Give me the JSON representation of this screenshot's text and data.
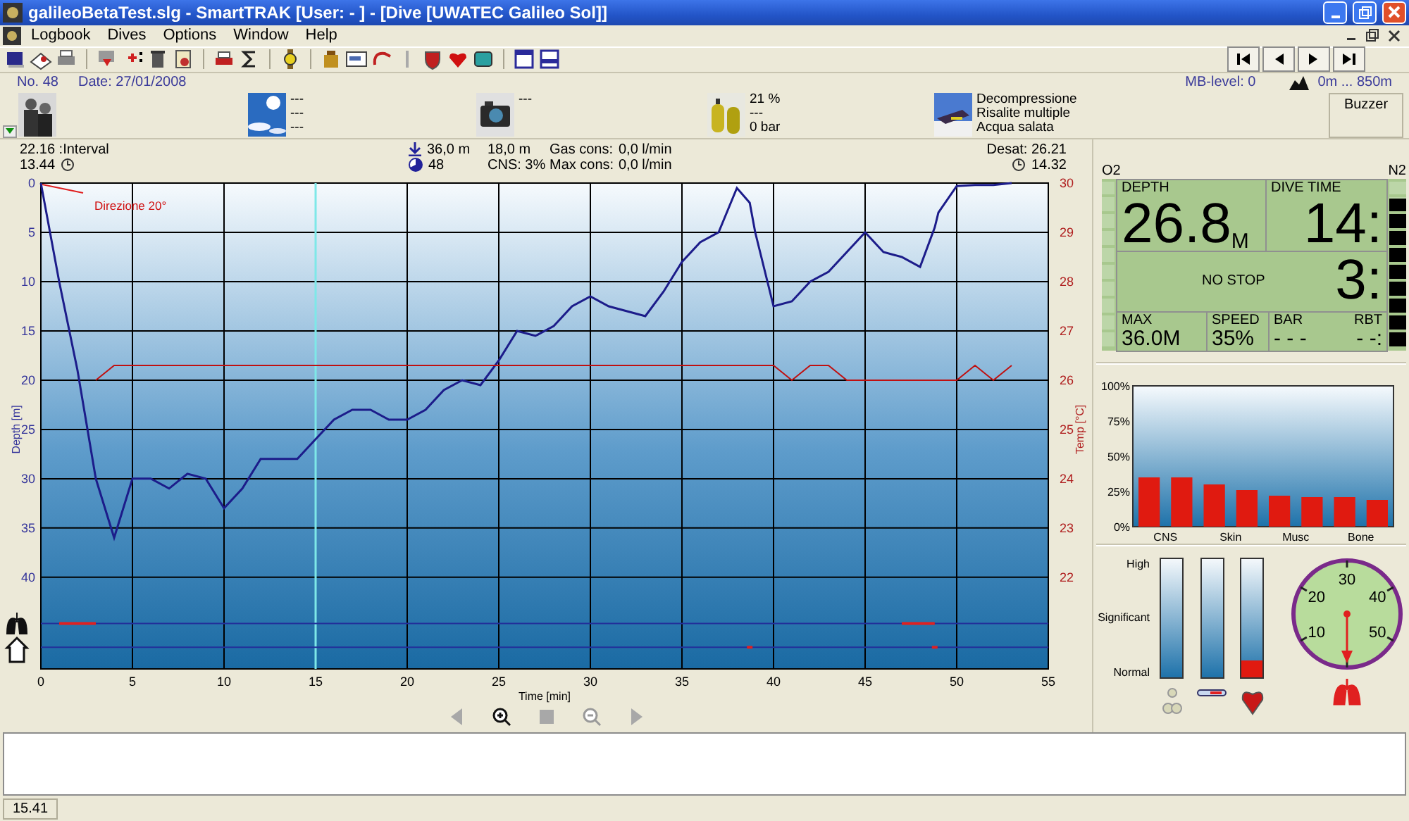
{
  "window": {
    "title": "galileoBetaTest.slg - SmartTRAK  [User:  - ] - [Dive  [UWATEC Galileo Sol]]"
  },
  "menu": [
    "Logbook",
    "Dives",
    "Options",
    "Window",
    "Help"
  ],
  "dive_info": {
    "number": "No. 48",
    "date": "Date: 27/01/2008",
    "mb_level": "MB-level: 0",
    "altitude": "0m ... 850m"
  },
  "summary": [
    {
      "kind": "buddy"
    },
    {
      "kind": "weather",
      "lines": [
        "---",
        "---",
        "---"
      ]
    },
    {
      "kind": "equipment",
      "lines": [
        "---"
      ]
    },
    {
      "kind": "gas",
      "lines": [
        "21 %",
        "---",
        "0 bar"
      ]
    },
    {
      "kind": "dive_type",
      "lines": [
        "Decompressione",
        "Risalite multiple",
        "Acqua salata"
      ]
    }
  ],
  "buzzer": "Buzzer",
  "stats": {
    "interval": "22.16 :Interval",
    "interval_time": "13.44",
    "max_depth": "36,0 m",
    "avg_depth": "18,0 m",
    "cns_count": "48",
    "cns": "CNS: 3%",
    "gas_cons_label": "Gas cons:",
    "gas_cons": "0,0 l/min",
    "max_cons_label": "Max cons:",
    "max_cons": "0,0 l/min",
    "desat": "Desat: 26.21",
    "desat_time": "14.32"
  },
  "profile": {
    "chart_data": {
      "type": "line",
      "xlabel": "Time [min]",
      "ylabel": "Depth [m]",
      "y2label": "Temp [°C]",
      "grid": true,
      "x": [
        0,
        1,
        2,
        3,
        4,
        5,
        6,
        7,
        8,
        9,
        10,
        11,
        12,
        13,
        14,
        15,
        16,
        17,
        18,
        19,
        20,
        21,
        22,
        23,
        24,
        25,
        26,
        27,
        28,
        29,
        30,
        31,
        32,
        33,
        34,
        35,
        36,
        37,
        38,
        38.7,
        39,
        40,
        41,
        42,
        43,
        44,
        45,
        46,
        47,
        48,
        48.8,
        49,
        50,
        51,
        52,
        53
      ],
      "series": [
        {
          "color": "#1c1c8a",
          "values": [
            0,
            10,
            19,
            30,
            36,
            30,
            30,
            31,
            29.5,
            30,
            33,
            31,
            28,
            28,
            28,
            26,
            24,
            23,
            23,
            24,
            24,
            23,
            21,
            20,
            20.5,
            18,
            15,
            15.5,
            14.5,
            12.5,
            11.5,
            12.5,
            13,
            13.5,
            11,
            8,
            6,
            5,
            0.5,
            2,
            5,
            12.5,
            12,
            10,
            9,
            7,
            5,
            7,
            7.5,
            8.5,
            4.5,
            3,
            0.3,
            0.2,
            0.2,
            0
          ]
        },
        {
          "color": "#e02020",
          "values": [
            null,
            44.7,
            44.7,
            44.7,
            null,
            null,
            null,
            null,
            null,
            null,
            null,
            null,
            null,
            null,
            null,
            null,
            null,
            null,
            null,
            null,
            null,
            null,
            null,
            null,
            null,
            null,
            null,
            null,
            null,
            null,
            null,
            null,
            null,
            null,
            null,
            null,
            null,
            null,
            null,
            null,
            null,
            null,
            null,
            null,
            null,
            null,
            null,
            null,
            44.7,
            44.7,
            44.7,
            null,
            null,
            null,
            null,
            null
          ]
        },
        {
          "color": "#e02021",
          "values": [
            null,
            null,
            null,
            null,
            null,
            null,
            null,
            null,
            null,
            null,
            null,
            null,
            null,
            null,
            null,
            null,
            null,
            null,
            null,
            null,
            null,
            null,
            null,
            null,
            null,
            null,
            null,
            null,
            null,
            null,
            null,
            null,
            null,
            null,
            null,
            null,
            null,
            null,
            null,
            47.1,
            null,
            null,
            null,
            null,
            null,
            null,
            null,
            null,
            null,
            null,
            47.1,
            null,
            null,
            null,
            null,
            null
          ]
        },
        {
          "color": "#c01010",
          "axis": "y2",
          "values": [
            null,
            null,
            null,
            26,
            26.3,
            26.3,
            26.3,
            26.3,
            26.3,
            26.3,
            26.3,
            26.3,
            26.3,
            26.3,
            26.3,
            26.3,
            26.3,
            26.3,
            26.3,
            26.3,
            26.3,
            26.3,
            26.3,
            26.3,
            26.3,
            26.3,
            26.3,
            26.3,
            26.3,
            26.3,
            26.3,
            26.3,
            26.3,
            26.3,
            26.3,
            26.3,
            26.3,
            26.3,
            26.3,
            26.3,
            26.3,
            26.3,
            26,
            26.3,
            26.3,
            26,
            26,
            26,
            26,
            26,
            26,
            26,
            26,
            26.3,
            26,
            26.3
          ]
        }
      ],
      "xlim": [
        0,
        55
      ],
      "ylim": [
        49.3,
        0
      ],
      "y2lim": [
        20.14,
        30
      ],
      "xticks": [
        0,
        5,
        10,
        15,
        20,
        25,
        30,
        35,
        40,
        45,
        50,
        55
      ],
      "yticks": [
        0,
        5,
        10,
        15,
        20,
        25,
        30,
        35,
        40
      ],
      "y2ticks": [
        30,
        29,
        28,
        27,
        26,
        25,
        24,
        23,
        22
      ],
      "ref_lines": [
        {
          "axis": "x",
          "value": 15,
          "color": "#7ee8e8"
        },
        {
          "axis": "y",
          "value": 44.7,
          "color": "#22309a"
        },
        {
          "axis": "y",
          "value": 47.1,
          "color": "#22309a"
        }
      ],
      "annotations": [
        {
          "text": "Direzione 20°",
          "x": 0,
          "y": 0
        }
      ]
    }
  },
  "computer": {
    "o2_label": "O2",
    "n2_label": "N2",
    "o2_bar": {
      "level": 0
    },
    "n2_bar": {
      "level": 0.9
    },
    "depth_label": "DEPTH",
    "depth": "26.8",
    "depth_unit": "M",
    "time_label": "DIVE TIME",
    "time": "14:",
    "no_stop": "NO STOP",
    "no_stop_time": "3:",
    "max_label": "MAX",
    "max": "36.0M",
    "speed_label": "SPEED",
    "speed": "35%",
    "bar_label": "BAR",
    "bar": "- - -",
    "rbt_label": "RBT",
    "rbt": "- -:"
  },
  "tissues": {
    "chart_data": {
      "type": "bar",
      "categories": [
        "CNS",
        null,
        "Skin",
        null,
        "Musc",
        null,
        "Bone",
        null
      ],
      "values": [
        35,
        35,
        30,
        26,
        22,
        21,
        21,
        19
      ],
      "ylim": [
        0,
        100
      ],
      "yticks": [
        {
          "value": 100,
          "label": "100%"
        },
        {
          "value": 75,
          "label": "75%"
        },
        {
          "value": 50,
          "label": "50%"
        },
        {
          "value": 25,
          "label": "25%"
        },
        {
          "value": 0,
          "label": "0%"
        }
      ]
    }
  },
  "meters": {
    "scale": [
      "High",
      "Significant",
      "Normal"
    ],
    "items": [
      {
        "kind": "bubbles",
        "level": 0
      },
      {
        "kind": "thermometer",
        "level": 0
      },
      {
        "kind": "heart",
        "level": 0.14
      }
    ]
  },
  "dial": {
    "labels": [
      "10",
      "20",
      "30",
      "40",
      "50"
    ]
  },
  "status_bar": "15.41"
}
